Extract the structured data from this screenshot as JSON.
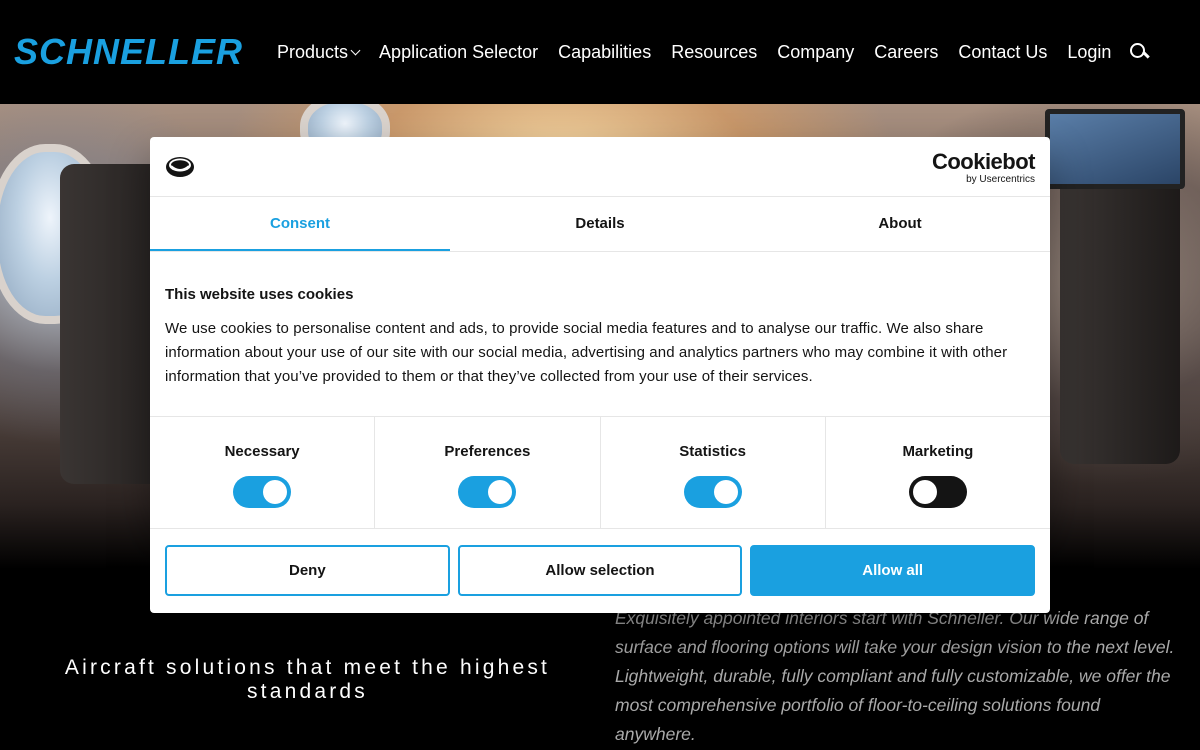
{
  "header": {
    "logo_text": "SCHNELLER",
    "nav": [
      {
        "label": "Products",
        "has_dropdown": true
      },
      {
        "label": "Application Selector"
      },
      {
        "label": "Capabilities"
      },
      {
        "label": "Resources"
      },
      {
        "label": "Company"
      },
      {
        "label": "Careers"
      },
      {
        "label": "Contact Us"
      },
      {
        "label": "Login"
      }
    ],
    "search_icon": "search-icon"
  },
  "hero": {
    "title": "Aircraft solutions that meet the highest standards",
    "description": "Exquisitely appointed interiors start with Schneller. Our wide range of surface and flooring options will take your design vision to the next level. Lightweight, durable, fully compliant and fully customizable, we offer the most comprehensive portfolio of floor-to-ceiling solutions found anywhere."
  },
  "cookie_dialog": {
    "brand": {
      "name": "Cookiebot",
      "sub": "by Usercentrics"
    },
    "tabs": [
      {
        "label": "Consent",
        "active": true
      },
      {
        "label": "Details",
        "active": false
      },
      {
        "label": "About",
        "active": false
      }
    ],
    "heading": "This website uses cookies",
    "body": "We use cookies to personalise content and ads, to provide social media features and to analyse our traffic. We also share information about your use of our site with our social media, advertising and analytics partners who may combine it with other information that you’ve provided to them or that they’ve collected from your use of their services.",
    "toggles": [
      {
        "label": "Necessary",
        "on": true
      },
      {
        "label": "Preferences",
        "on": true
      },
      {
        "label": "Statistics",
        "on": true
      },
      {
        "label": "Marketing",
        "on": false
      }
    ],
    "buttons": {
      "deny": "Deny",
      "allow_selection": "Allow selection",
      "allow_all": "Allow all"
    }
  },
  "colors": {
    "accent": "#1aa0e0",
    "text": "#141414",
    "header_bg": "#000000"
  }
}
